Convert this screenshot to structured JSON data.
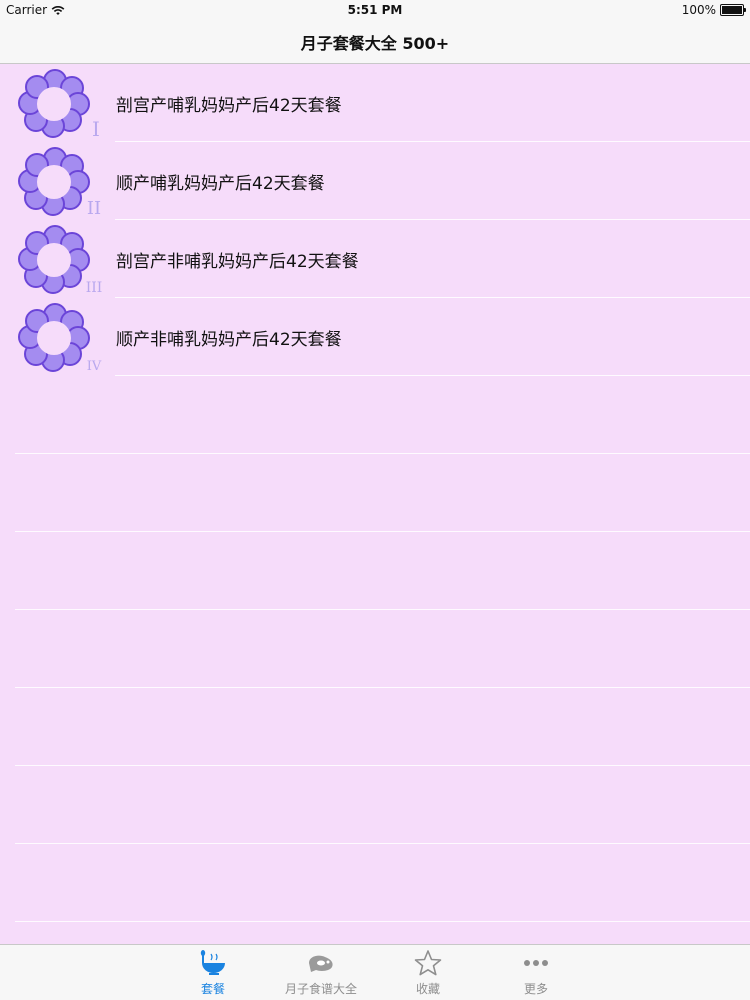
{
  "status_bar": {
    "carrier": "Carrier",
    "time": "5:51 PM",
    "battery": "100%"
  },
  "nav": {
    "title": "月子套餐大全 500+"
  },
  "list": {
    "items": [
      {
        "label": "剖宫产哺乳妈妈产后42天套餐",
        "badge": "I"
      },
      {
        "label": "顺产哺乳妈妈产后42天套餐",
        "badge": "II"
      },
      {
        "label": "剖宫产非哺乳妈妈产后42天套餐",
        "badge": "III"
      },
      {
        "label": "顺产非哺乳妈妈产后42天套餐",
        "badge": "IV"
      }
    ]
  },
  "tabs": [
    {
      "label": "套餐",
      "icon": "bowl-icon",
      "active": true
    },
    {
      "label": "月子食谱大全",
      "icon": "meat-icon",
      "active": false
    },
    {
      "label": "收藏",
      "icon": "star-icon",
      "active": false
    },
    {
      "label": "更多",
      "icon": "more-dots-icon",
      "active": false
    }
  ],
  "colors": {
    "background": "#f6dcfa",
    "accent": "#1a83e0",
    "flower": "#8a6fe0"
  }
}
